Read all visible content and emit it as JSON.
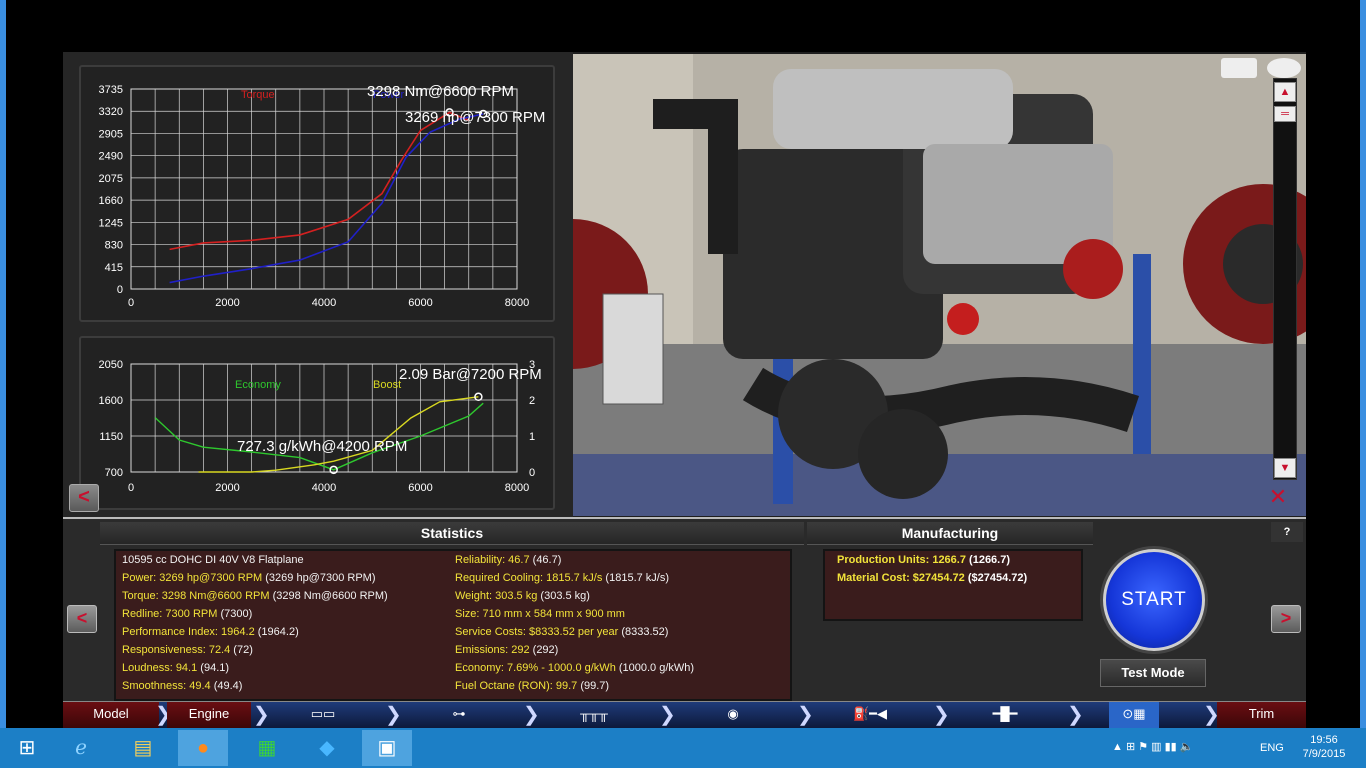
{
  "graphs": {
    "power_torque": {
      "y_ticks": [
        "3735",
        "3320",
        "2905",
        "2490",
        "2075",
        "1660",
        "1245",
        "830",
        "415",
        "0"
      ],
      "x_ticks": [
        "0",
        "2000",
        "4000",
        "6000",
        "8000"
      ],
      "torque_label": "Torque",
      "power_label": "Power",
      "torque_peak": "3298 Nm@6600 RPM",
      "power_peak": "3269 hp@7300 RPM"
    },
    "economy_boost": {
      "y_left_ticks": [
        "2050",
        "1600",
        "1150",
        "700"
      ],
      "y_right_ticks": [
        "3",
        "2",
        "1",
        "0"
      ],
      "x_ticks": [
        "0",
        "2000",
        "4000",
        "6000",
        "8000"
      ],
      "economy_label": "Economy",
      "boost_label": "Boost",
      "boost_peak": "2.09 Bar@7200 RPM",
      "economy_min": "727.3 g/kWh@4200 RPM"
    }
  },
  "chart_data": [
    {
      "type": "line",
      "title": "",
      "xlabel": "",
      "ylabel": "",
      "xlim": [
        0,
        8000
      ],
      "ylim": [
        0,
        3735
      ],
      "grid": true,
      "series": [
        {
          "name": "Torque",
          "color": "#d42020",
          "x": [
            800,
            1500,
            2500,
            3500,
            4500,
            5200,
            5600,
            6000,
            6600,
            7000
          ],
          "y": [
            740,
            860,
            910,
            1010,
            1300,
            1780,
            2400,
            2960,
            3298,
            3150
          ]
        },
        {
          "name": "Power",
          "color": "#2020c8",
          "x": [
            800,
            1500,
            2500,
            3500,
            4500,
            5200,
            5700,
            6200,
            6800,
            7300
          ],
          "y": [
            120,
            240,
            380,
            540,
            880,
            1600,
            2460,
            2930,
            3170,
            3269
          ]
        }
      ],
      "annotations": [
        "3298 Nm@6600 RPM",
        "3269 hp@7300 RPM"
      ]
    },
    {
      "type": "line",
      "title": "",
      "xlim": [
        0,
        8000
      ],
      "ylim": [
        700,
        2050
      ],
      "y2lim": [
        0,
        3
      ],
      "grid": true,
      "series": [
        {
          "name": "Economy",
          "color": "#2ec82e",
          "axis": "left",
          "x": [
            500,
            1000,
            1500,
            2500,
            3500,
            4200,
            5000,
            6000,
            7000,
            7300
          ],
          "y": [
            1380,
            1100,
            1010,
            950,
            880,
            727.3,
            940,
            1150,
            1400,
            1560
          ]
        },
        {
          "name": "Boost",
          "color": "#d8d820",
          "axis": "right",
          "x": [
            1400,
            2500,
            3000,
            3800,
            4200,
            5000,
            5800,
            6400,
            7200
          ],
          "y": [
            0,
            0,
            0.05,
            0.2,
            0.3,
            0.6,
            1.5,
            1.95,
            2.09
          ]
        }
      ],
      "annotations": [
        "2.09 Bar@7200 RPM",
        "727.3 g/kWh@4200 RPM"
      ]
    }
  ],
  "statistics": {
    "title": "Statistics",
    "col1": [
      {
        "plain": "10595 cc DOHC DI 40V V8 Flatplane"
      },
      {
        "lab": "Power: 3269 hp@7300 RPM",
        "val": " (3269 hp@7300 RPM)"
      },
      {
        "lab": "Torque: 3298 Nm@6600 RPM",
        "val": " (3298 Nm@6600 RPM)"
      },
      {
        "lab": "Redline: 7300 RPM",
        "val": " (7300)"
      },
      {
        "lab": "Performance Index: 1964.2",
        "val": " (1964.2)"
      },
      {
        "lab": "Responsiveness: 72.4",
        "val": " (72)"
      },
      {
        "lab": "Loudness: 94.1",
        "val": " (94.1)"
      },
      {
        "lab": "Smoothness: 49.4",
        "val": " (49.4)"
      }
    ],
    "col2": [
      {
        "lab": "Reliability: 46.7",
        "val": " (46.7)"
      },
      {
        "lab": "Required Cooling: 1815.7 kJ/s",
        "val": " (1815.7 kJ/s)"
      },
      {
        "lab": "Weight: 303.5 kg",
        "val": " (303.5 kg)"
      },
      {
        "lab": "Size: 710 mm x 584 mm x 900 mm",
        "val": ""
      },
      {
        "lab": "Service Costs: $8333.52 per year",
        "val": " (8333.52)"
      },
      {
        "lab": "Emissions: 292",
        "val": " (292)"
      },
      {
        "lab": "Economy: 7.69% - 1000.0 g/kWh",
        "val": " (1000.0 g/kWh)"
      },
      {
        "lab": "Fuel Octane (RON): 99.7",
        "val": " (99.7)"
      }
    ]
  },
  "manufacturing": {
    "title": "Manufacturing",
    "rows": [
      {
        "lab": "Production Units: 1266.7",
        "val": " (1266.7)"
      },
      {
        "lab": "Material Cost: $27454.72",
        "val": " ($27454.72)"
      }
    ]
  },
  "controls": {
    "start": "START",
    "test_mode": "Test Mode",
    "help": "?",
    "back": "<",
    "prev": "<",
    "next": ">"
  },
  "navbar": {
    "model": "Model",
    "engine": "Engine",
    "trim": "Trim",
    "icons": [
      "block-icon",
      "piston-icon",
      "valvetrain-icon",
      "turbo-icon",
      "fuel-icon",
      "exhaust-icon",
      "tuning-icon"
    ]
  },
  "taskbar": {
    "lang": "ENG",
    "time": "19:56",
    "date": "7/9/2015"
  },
  "colors": {
    "torque": "#d42020",
    "power": "#2020c8",
    "economy": "#2ec82e",
    "boost": "#d8d820",
    "stat_label": "#f2e33a",
    "start_button": "#1536d8"
  }
}
